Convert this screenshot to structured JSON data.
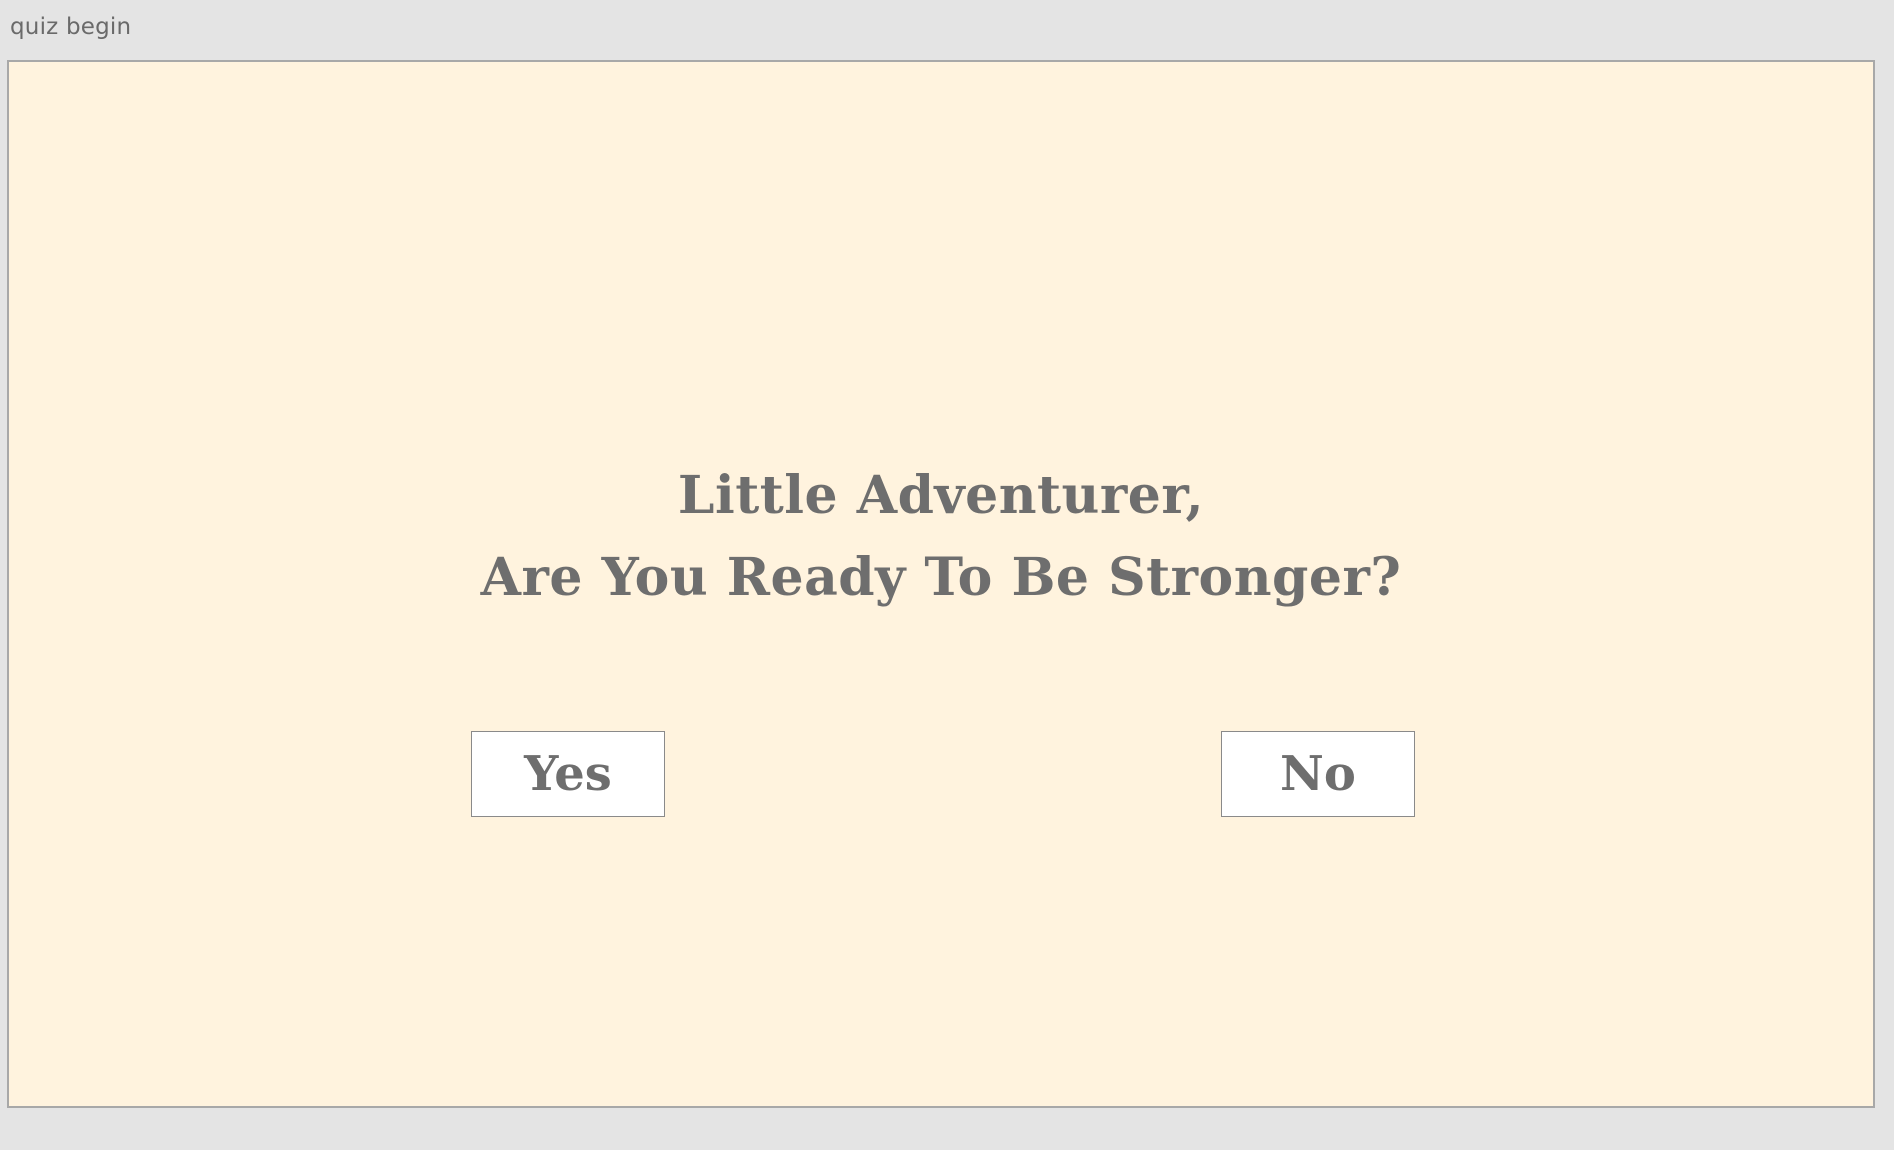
{
  "frame": {
    "label": "quiz begin"
  },
  "quiz": {
    "headline_line1": "Little Adventurer,",
    "headline_line2": "Are You Ready To Be Stronger?",
    "yes_label": "Yes",
    "no_label": "No"
  },
  "colors": {
    "canvas_background": "#e4e4e4",
    "artboard_background": "#fff3de",
    "text": "#6e6e6e",
    "button_background": "#ffffff"
  }
}
